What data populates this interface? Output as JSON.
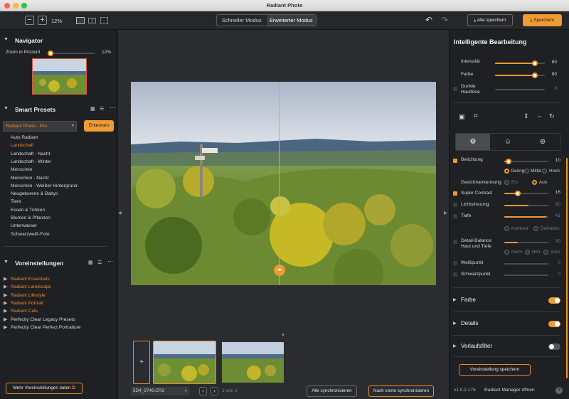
{
  "window": {
    "title": "Radiant Photo"
  },
  "toolbar": {
    "zoom_out": "−",
    "zoom_in": "+",
    "zoom": "12%",
    "modes": [
      "Schneller Modus",
      "Erweiterter Modus"
    ],
    "save_all": "Alle speichern",
    "save": "Speichern"
  },
  "navigator": {
    "title": "Navigator",
    "zoom_label": "Zoom in Prozent",
    "zoom_value": "12%",
    "zoom_fraction": 0.0
  },
  "smart_presets": {
    "title": "Smart Presets",
    "selected": "Radiant Photo - Pro",
    "detect": "Erkennen",
    "items": [
      "Auto Radiant",
      "Landschaft",
      "Landschaft - Nacht",
      "Landschaft - Winter",
      "Menschen",
      "Menschen - Nacht",
      "Menschen - Weißer Hintergrund",
      "Neugeborene & Babys",
      "Tiere",
      "Essen & Trinken",
      "Blumen & Pflanzen",
      "Unterwasser",
      "Schwarzweiß-Foto"
    ],
    "active_index": 1
  },
  "voreinstellungen": {
    "title": "Voreinstellungen",
    "items": [
      {
        "label": "Radiant Essentials",
        "orange": true
      },
      {
        "label": "Radiant Landscape",
        "orange": true
      },
      {
        "label": "Radiant Lifestyle",
        "orange": true
      },
      {
        "label": "Radiant Portrait",
        "orange": true
      },
      {
        "label": "Radiant Cats",
        "orange": true
      },
      {
        "label": "Perfectly Clear Legacy Presets",
        "orange": false
      },
      {
        "label": "Perfectly Clear Perfect Portraiture",
        "orange": false
      }
    ],
    "load_more": "Mehr Voreinstellungen laden"
  },
  "filmstrip": {
    "filename": "5D4_3746.CR2",
    "pager": "1 von 2",
    "sync_all": "Alle synchronisieren",
    "sync_forward": "Nach vorne synchronisieren",
    "add": "+"
  },
  "right": {
    "title": "Intelligente Bearbeitung",
    "intensity": {
      "label": "Intensität",
      "value": "80",
      "fraction": 0.8
    },
    "color": {
      "label": "Farbe",
      "value": "80",
      "fraction": 0.8
    },
    "dark_skin": {
      "label1": "Dunkle",
      "label2": "Hauttöne",
      "value": "0",
      "fraction": 0.0
    },
    "belichtung": {
      "label": "Belichtung",
      "value": "10",
      "fraction": 0.1,
      "options": [
        "Gering",
        "Mittel",
        "Hoch"
      ]
    },
    "face": {
      "label": "Gesichtserkennung",
      "options": [
        "Ein",
        "Aus"
      ]
    },
    "super_contrast": {
      "label": "Super Contrast",
      "value": "16",
      "fraction": 0.3
    },
    "lichtstreuung": {
      "label": "Lichtstreuung",
      "value": "60",
      "fraction": 0.55
    },
    "tiefe": {
      "label": "Tiefe",
      "value": "41",
      "fraction": 0.95,
      "options": [
        "Kontrast",
        "Definition"
      ]
    },
    "detail": {
      "label1": "Detail-Balance",
      "label2": "Haut und Tiefe",
      "value": "30",
      "fraction": 0.3,
      "options": [
        "Norm",
        "Hell",
        "Auto"
      ]
    },
    "weisspunkt": {
      "label": "Weißpunkt",
      "value": "0",
      "fraction": 0.0
    },
    "schwarzpunkt": {
      "label": "Schwarzpunkt",
      "value": "0",
      "fraction": 0.0
    },
    "sections": [
      {
        "label": "Farbe",
        "on": true
      },
      {
        "label": "Details",
        "on": true
      },
      {
        "label": "Verlaufsfilter",
        "on": false
      }
    ],
    "save_preset": "Voreinstellung speichern",
    "version": "v1.0.1.176",
    "manager": "Radiant Manager öffnen",
    "help": "?"
  },
  "colors": {
    "accent": "#ef9a33"
  }
}
